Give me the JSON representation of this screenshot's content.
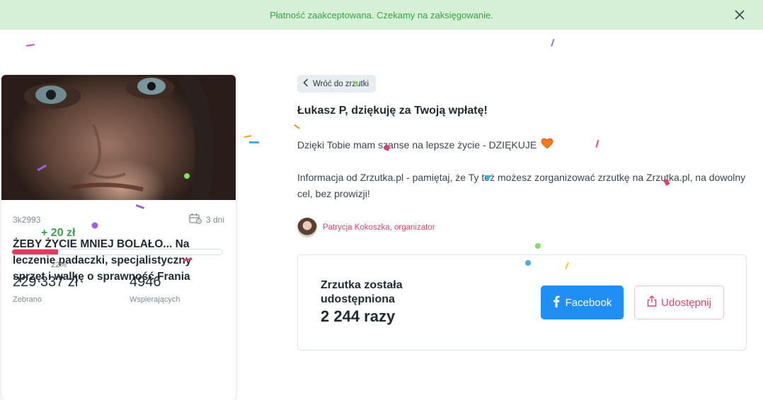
{
  "banner": {
    "text": "Płatność zaakceptowana. Czekamy na zaksięgowanie.",
    "close_icon": "close-icon"
  },
  "card": {
    "id": "3k2993",
    "days": "3 dni",
    "title": "ŻEBY ŻYCIE MNIEJ BOLAŁO... Na leczenie padaczki, specjalistyczny sprzęt i walkę o sprawność Frania",
    "increment": "+ 20 zł",
    "progress_percent": "22%",
    "progress_value": 22,
    "collected_value": "229 337 zł",
    "collected_label": "Zebrano",
    "supporters_value": "4946",
    "supporters_label": "Wspierających"
  },
  "main": {
    "back_label": "Wróć do zrzutki",
    "thanks_title": "Łukasz P, dziękuję za Twoją wpłatę!",
    "message": "Dzięki Tobie mam szanse na lepsze życie - DZIĘKUJE",
    "info": "Informacja od Zrzutka.pl - pamiętaj, że Ty też możesz zorganizować zrzutkę na Zrzutka.pl, na dowolny cel, bez prowizji!",
    "organizer": "Patrycja Kokoszka, organizator"
  },
  "share": {
    "caption": "Zrzutka została udostępniona",
    "count": "2 244 razy",
    "facebook_label": "Facebook",
    "share_label": "Udostępnij"
  },
  "colors": {
    "accent": "#e23b5e",
    "success": "#3aa046",
    "facebook": "#1f8ff5",
    "banner_bg": "#d6f0d8"
  }
}
